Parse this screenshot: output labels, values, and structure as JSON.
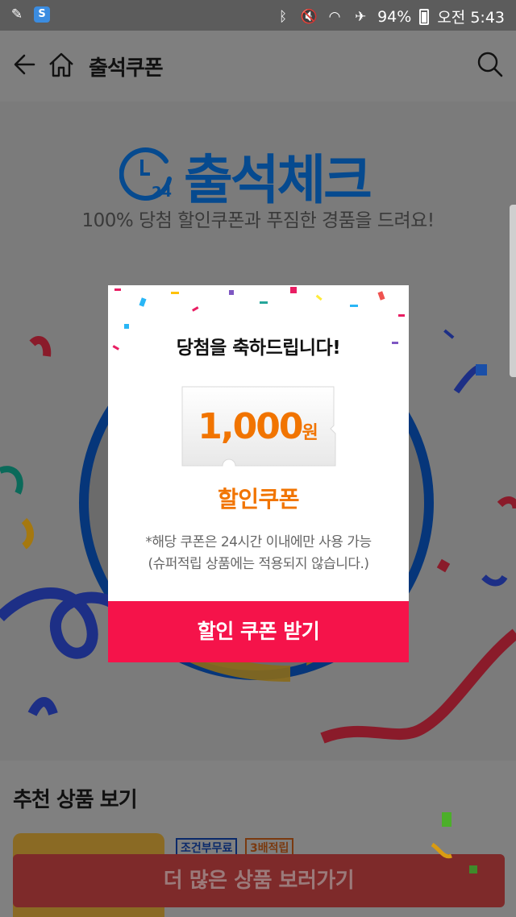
{
  "status_bar": {
    "battery": "94%",
    "time": "오전 5:43",
    "icons": [
      "app-icon",
      "s-app-icon",
      "bluetooth-icon",
      "mute-icon",
      "wifi-icon",
      "airplane-icon",
      "battery-icon"
    ]
  },
  "header": {
    "title": "출석쿠폰"
  },
  "banner": {
    "logo_number": "24",
    "title": "출석체크",
    "subtitle": "100% 당첨 할인쿠폰과 푸짐한 경품을 드려요!"
  },
  "modal": {
    "title": "당첨을 축하드립니다!",
    "amount": "1,000",
    "unit": "원",
    "coupon_label": "할인쿠폰",
    "note_line1": "*해당 쿠폰은 24시간 이내에만 사용 가능",
    "note_line2": "(슈퍼적립 상품에는 적용되지 않습니다.)",
    "button_label": "할인 쿠폰 받기"
  },
  "recommend": {
    "title": "추천 상품 보기",
    "badges": [
      "조건부무료",
      "3배적립"
    ],
    "more_button": "더 많은 상품 보러가기"
  },
  "colors": {
    "accent": "#f5134a",
    "coupon_orange": "#f17400",
    "brand_blue": "#064a8f"
  }
}
